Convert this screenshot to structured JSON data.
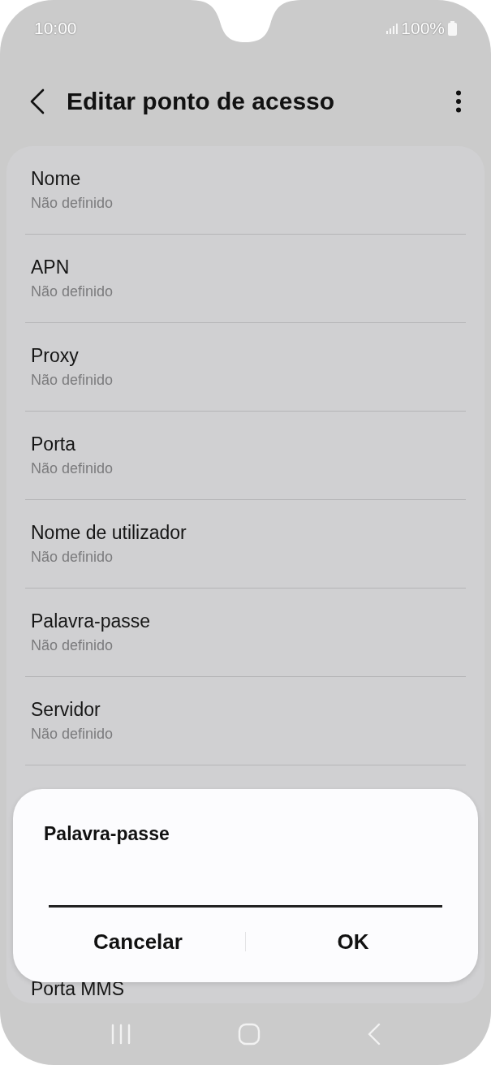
{
  "status_bar": {
    "time": "10:00",
    "battery": "100%"
  },
  "header": {
    "title": "Editar ponto de acesso"
  },
  "settings": [
    {
      "title": "Nome",
      "value": "Não definido"
    },
    {
      "title": "APN",
      "value": "Não definido"
    },
    {
      "title": "Proxy",
      "value": "Não definido"
    },
    {
      "title": "Porta",
      "value": "Não definido"
    },
    {
      "title": "Nome de utilizador",
      "value": "Não definido"
    },
    {
      "title": "Palavra-passe",
      "value": "Não definido"
    },
    {
      "title": "Servidor",
      "value": "Não definido"
    }
  ],
  "covered_setting": {
    "title": "Porta MMS"
  },
  "dialog": {
    "title": "Palavra-passe",
    "buttons": [
      "Cancelar",
      "OK"
    ]
  }
}
